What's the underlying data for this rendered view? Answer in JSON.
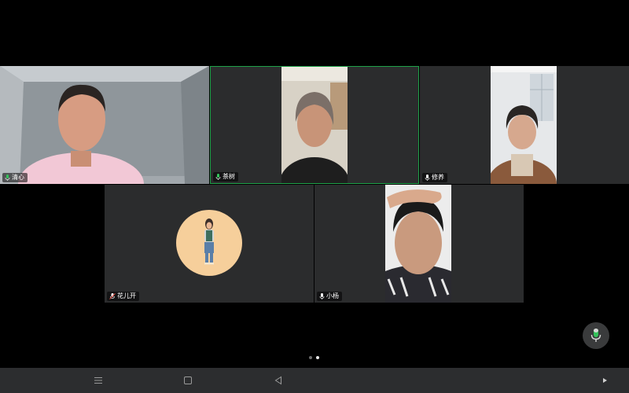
{
  "participants": [
    {
      "name": "清心",
      "mic": "on"
    },
    {
      "name": "茶树",
      "mic": "on",
      "active": true
    },
    {
      "name": "修养",
      "mic": "on"
    },
    {
      "name": "花儿开",
      "mic": "muted"
    },
    {
      "name": "小杨",
      "mic": "on"
    }
  ],
  "pagination": {
    "pages": 2,
    "current": 2
  },
  "controls": {
    "mic_button_icon": "microphone-icon"
  },
  "navbar": {
    "icons": [
      "menu-icon",
      "home-square-icon",
      "back-triangle-icon",
      "play-triangle-icon"
    ]
  },
  "colors": {
    "active_speaker_border": "#1fa34a",
    "mic_green": "#35c25b",
    "tile_bg": "#2b2c2d"
  }
}
